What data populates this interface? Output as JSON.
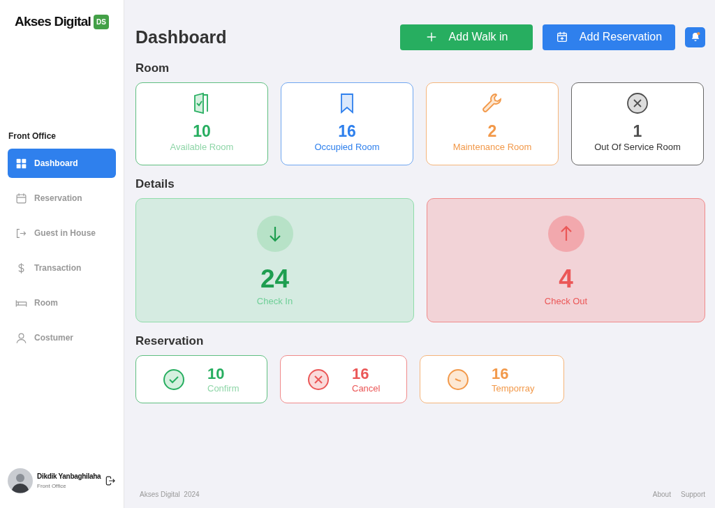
{
  "logo": {
    "text": "Akses Digital",
    "badge": "DS"
  },
  "sidebar": {
    "section": "Front Office",
    "items": [
      {
        "label": "Dashboard",
        "kind": "grid",
        "selected": true
      },
      {
        "label": "Reservation",
        "kind": "calendar",
        "selected": false
      },
      {
        "label": "Guest in House",
        "kind": "enter",
        "selected": false
      },
      {
        "label": "Transaction",
        "kind": "dollar",
        "selected": false
      },
      {
        "label": "Room",
        "kind": "bed",
        "selected": false
      },
      {
        "label": "Costumer",
        "kind": "user",
        "selected": false
      }
    ],
    "user": {
      "name": "Dikdik Yanbaghilaha",
      "role": "Front Office"
    }
  },
  "header": {
    "title": "Dashboard",
    "buttons": [
      {
        "label": "Add Walk in",
        "kind": "walkin"
      },
      {
        "label": "Add Reservation",
        "kind": "reservation"
      }
    ],
    "notification": true
  },
  "room": {
    "title": "Room",
    "cards": [
      {
        "kind": "available",
        "value": "10",
        "label": "Available Room"
      },
      {
        "kind": "occupied",
        "value": "16",
        "label": "Occupied Room"
      },
      {
        "kind": "maintenance",
        "value": "2",
        "label": "Maintenance Room"
      },
      {
        "kind": "out_of_service",
        "value": "1",
        "label": "Out Of Service Room"
      }
    ]
  },
  "details": {
    "title": "Details",
    "cards": [
      {
        "kind": "checkin",
        "value": "24",
        "label": "Check In"
      },
      {
        "kind": "checkout",
        "value": "4",
        "label": "Check Out"
      }
    ]
  },
  "reservation": {
    "title": "Reservation",
    "cards": [
      {
        "kind": "confirm",
        "value": "10",
        "label": "Confirm"
      },
      {
        "kind": "cancel",
        "value": "16",
        "label": "Cancel"
      },
      {
        "kind": "temporary",
        "value": "16",
        "label": "Temporray"
      }
    ]
  },
  "footer": {
    "copyright": "Akses Digital  2024",
    "links": [
      "About",
      "Support"
    ]
  }
}
